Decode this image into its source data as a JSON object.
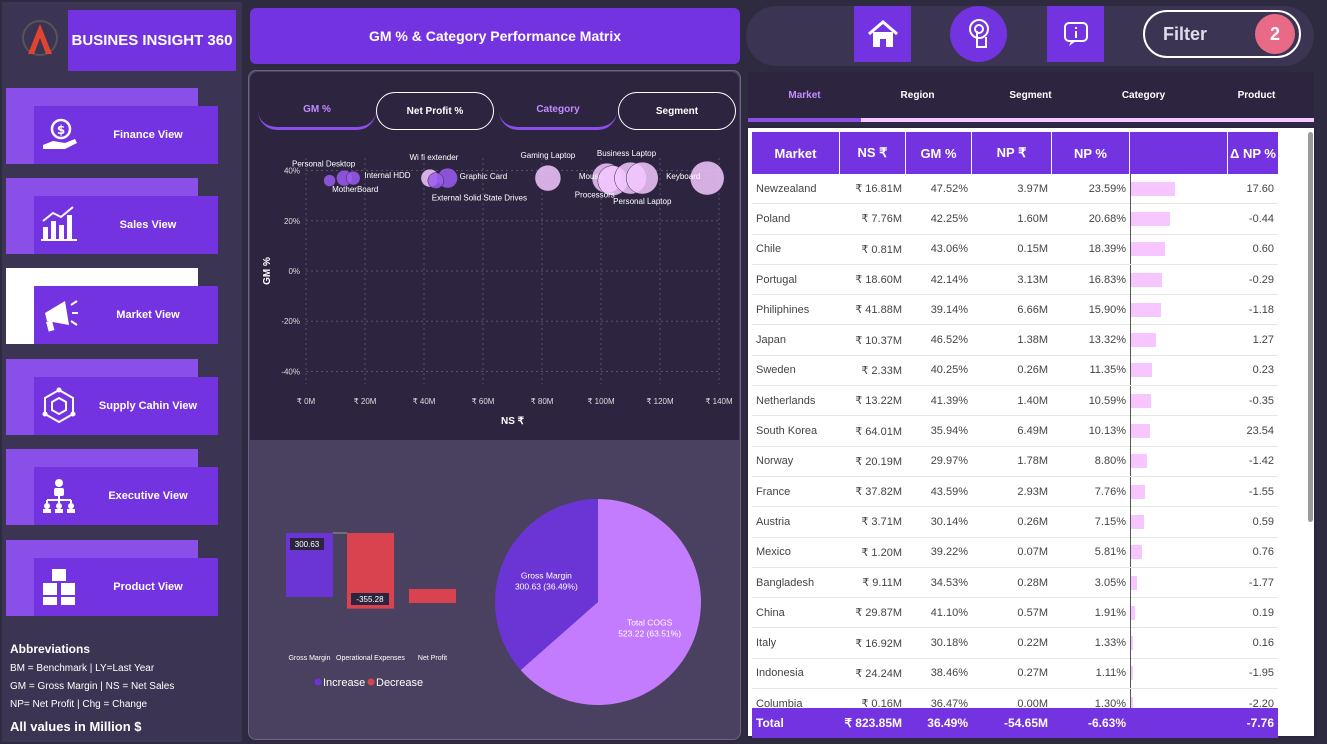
{
  "brand": {
    "title": "BUSINES INSIGHT 360"
  },
  "page_title": "GM % & Category Performance Matrix",
  "nav": [
    {
      "label": "Finance View",
      "icon": "hand-money-icon",
      "active": false
    },
    {
      "label": "Sales View",
      "icon": "bar-growth-icon",
      "active": false
    },
    {
      "label": "Market View",
      "icon": "megaphone-icon",
      "active": true
    },
    {
      "label": "Supply Cahin View",
      "icon": "network-box-icon",
      "active": false
    },
    {
      "label": "Executive View",
      "icon": "org-chart-icon",
      "active": false
    },
    {
      "label": "Product View",
      "icon": "boxes-icon",
      "active": false
    }
  ],
  "abbreviations": {
    "title": "Abbreviations",
    "lines": [
      "BM = Benchmark | LY=Last Year",
      "GM = Gross Margin | NS = Net Sales",
      "NP= Net Profit | Chg = Change"
    ],
    "note": "All values in Million $"
  },
  "mid_tabs": [
    {
      "label": "GM %",
      "selected": true
    },
    {
      "label": "Net Profit %",
      "selected": false
    },
    {
      "label": "Category",
      "selected": true
    },
    {
      "label": "Segment",
      "selected": false
    }
  ],
  "topbar": {
    "home_icon": "home-icon",
    "touch_icon": "touch-icon",
    "info_icon": "info-icon",
    "filter_label": "Filter",
    "filter_count": "2"
  },
  "right_tabs": [
    "Market",
    "Region",
    "Segment",
    "Category",
    "Product"
  ],
  "table": {
    "headers": [
      "Market",
      "NS ₹",
      "GM %",
      "NP ₹",
      "NP %",
      "",
      "Δ NP %"
    ],
    "rows": [
      [
        "Newzealand",
        "₹ 16.81M",
        "47.52%",
        "3.97M",
        "23.59%",
        "17.60"
      ],
      [
        "Poland",
        "₹ 7.76M",
        "42.25%",
        "1.60M",
        "20.68%",
        "-0.44"
      ],
      [
        "Chile",
        "₹ 0.81M",
        "43.06%",
        "0.15M",
        "18.39%",
        "0.60"
      ],
      [
        "Portugal",
        "₹ 18.60M",
        "42.14%",
        "3.13M",
        "16.83%",
        "-0.29"
      ],
      [
        "Philiphines",
        "₹ 41.88M",
        "39.14%",
        "6.66M",
        "15.90%",
        "-1.18"
      ],
      [
        "Japan",
        "₹ 10.37M",
        "46.52%",
        "1.38M",
        "13.32%",
        "1.27"
      ],
      [
        "Sweden",
        "₹ 2.33M",
        "40.25%",
        "0.26M",
        "11.35%",
        "0.23"
      ],
      [
        "Netherlands",
        "₹ 13.22M",
        "41.39%",
        "1.40M",
        "10.59%",
        "-0.35"
      ],
      [
        "South Korea",
        "₹ 64.01M",
        "35.94%",
        "6.49M",
        "10.13%",
        "23.54"
      ],
      [
        "Norway",
        "₹ 20.19M",
        "29.97%",
        "1.78M",
        "8.80%",
        "-1.42"
      ],
      [
        "France",
        "₹ 37.82M",
        "43.59%",
        "2.93M",
        "7.76%",
        "-1.55"
      ],
      [
        "Austria",
        "₹ 3.71M",
        "30.14%",
        "0.26M",
        "7.15%",
        "0.59"
      ],
      [
        "Mexico",
        "₹ 1.20M",
        "39.22%",
        "0.07M",
        "5.81%",
        "0.76"
      ],
      [
        "Bangladesh",
        "₹ 9.11M",
        "34.53%",
        "0.28M",
        "3.05%",
        "-1.77"
      ],
      [
        "China",
        "₹ 29.87M",
        "41.10%",
        "0.57M",
        "1.91%",
        "0.19"
      ],
      [
        "Italy",
        "₹ 16.92M",
        "30.18%",
        "0.22M",
        "1.33%",
        "0.16"
      ],
      [
        "Indonesia",
        "₹ 24.24M",
        "38.46%",
        "0.27M",
        "1.11%",
        "-1.95"
      ],
      [
        "Columbia",
        "₹ 0.16M",
        "36.47%",
        "0.00M",
        "1.30%",
        "-2.20"
      ]
    ],
    "total": [
      "Total",
      "₹ 823.85M",
      "36.49%",
      "-54.65M",
      "-6.63%",
      "",
      "-7.76"
    ]
  },
  "chart_data": [
    {
      "type": "scatter",
      "xlabel": "NS ₹",
      "ylabel": "GM %",
      "x_ticks": [
        "₹ 0M",
        "₹ 20M",
        "₹ 40M",
        "₹ 60M",
        "₹ 80M",
        "₹ 100M",
        "₹ 120M",
        "₹ 140M"
      ],
      "y_ticks": [
        "40%",
        "20%",
        "0%",
        "-20%",
        "-40%"
      ],
      "xlim": [
        0,
        140
      ],
      "ylim": [
        -45,
        45
      ],
      "points": [
        {
          "label": "Personal Desktop",
          "x": 8,
          "y": 36,
          "r": 6
        },
        {
          "label": "Internal HDD",
          "x": 13,
          "y": 37,
          "r": 8
        },
        {
          "label": "MotherBoard",
          "x": 16,
          "y": 37,
          "r": 7
        },
        {
          "label": "Wi fi extender",
          "x": 42,
          "y": 37,
          "r": 9
        },
        {
          "label": "Graphic Card",
          "x": 48,
          "y": 37,
          "r": 10
        },
        {
          "label": "External Solid State Drives",
          "x": 44,
          "y": 36,
          "r": 8
        },
        {
          "label": "Gaming Laptop",
          "x": 82,
          "y": 37,
          "r": 13
        },
        {
          "label": "Mouse",
          "x": 102,
          "y": 37,
          "r": 15
        },
        {
          "label": "Processors",
          "x": 104,
          "y": 36,
          "r": 15
        },
        {
          "label": "Business Laptop",
          "x": 110,
          "y": 37,
          "r": 16
        },
        {
          "label": "Personal Laptop",
          "x": 114,
          "y": 37,
          "r": 16
        },
        {
          "label": "Keyboard",
          "x": 136,
          "y": 37,
          "r": 17
        }
      ],
      "colors": {
        "light": "#f3c7ff",
        "purple": "#9b5cf0"
      }
    },
    {
      "type": "bar",
      "subtype": "waterfall",
      "categories": [
        "Gross Margin",
        "Operational Expenses",
        "Net Profit"
      ],
      "values": [
        300.63,
        -355.28,
        -54.65
      ],
      "value_labels": [
        "300.63",
        "-355.28",
        ""
      ],
      "legend": [
        "Increase",
        "Decrease"
      ],
      "colors": {
        "increase": "#6b35d6",
        "decrease": "#d8434f"
      }
    },
    {
      "type": "pie",
      "slices": [
        {
          "label": "Gross Margin",
          "value": 300.63,
          "pct_label": "300.63 (36.49%)",
          "color": "#6b35d6"
        },
        {
          "label": "Total COGS",
          "value": 523.22,
          "pct_label": "523.22 (63.51%)",
          "color": "#c47cff"
        }
      ]
    }
  ]
}
